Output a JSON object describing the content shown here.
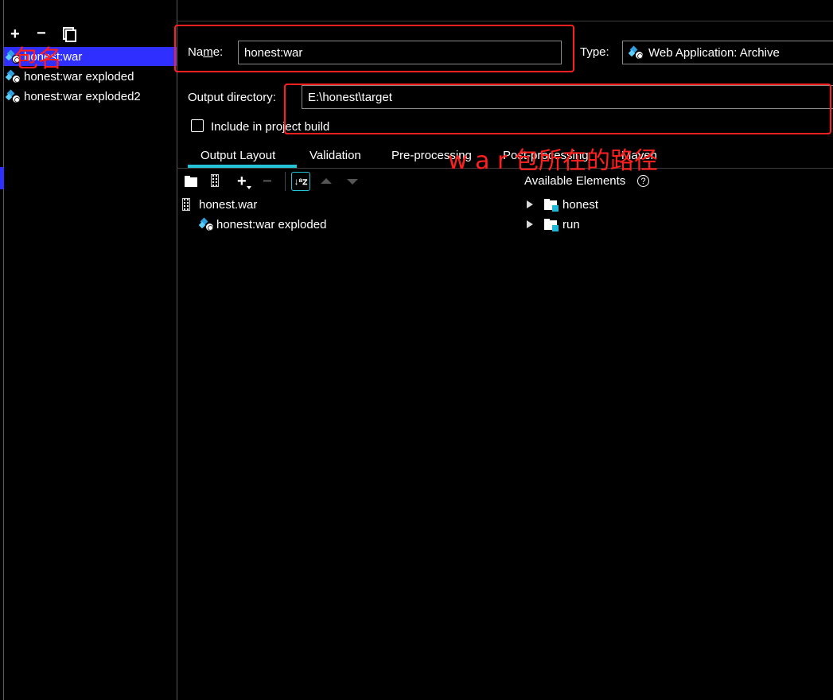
{
  "toolbar": {
    "add_glyph": "+",
    "remove_glyph": "−",
    "copy_icon": "copy-icon"
  },
  "artifacts": [
    {
      "label": "honest:war",
      "icon": "web-app-icon",
      "selected": true
    },
    {
      "label": "honest:war exploded",
      "icon": "web-app-icon",
      "selected": false
    },
    {
      "label": "honest:war exploded2",
      "icon": "web-app-icon",
      "selected": false
    }
  ],
  "form": {
    "name_label_pre": "Na",
    "name_label_mnemonic": "m",
    "name_label_post": "e:",
    "name_value": "honest:war",
    "type_label": "Type:",
    "type_value": "Web Application: Archive",
    "output_dir_label": "Output directory:",
    "output_dir_value": "E:\\honest\\target",
    "include_label": "Include in project build",
    "include_checked": false
  },
  "tabs": [
    {
      "label": "Output Layout",
      "active": true
    },
    {
      "label": "Validation",
      "active": false
    },
    {
      "label": "Pre-processing",
      "active": false
    },
    {
      "label": "Post-processing",
      "active": false
    },
    {
      "label": "Maven",
      "active": false
    }
  ],
  "layout_tree": [
    {
      "label": "honest.war",
      "icon": "war-archive-icon",
      "indent": 0
    },
    {
      "label": "honest:war exploded",
      "icon": "web-app-icon",
      "indent": 1
    }
  ],
  "available": {
    "title": "Available Elements",
    "items": [
      {
        "label": "honest",
        "icon": "module-folder-icon"
      },
      {
        "label": "run",
        "icon": "module-folder-icon"
      }
    ]
  },
  "annotations": {
    "name_note": "包名",
    "path_note": "w a r 包所在的路径"
  },
  "colors": {
    "background": "#000000",
    "selection": "#2f2fff",
    "accent": "#25c3d8",
    "annotation": "#ff1f1f"
  }
}
